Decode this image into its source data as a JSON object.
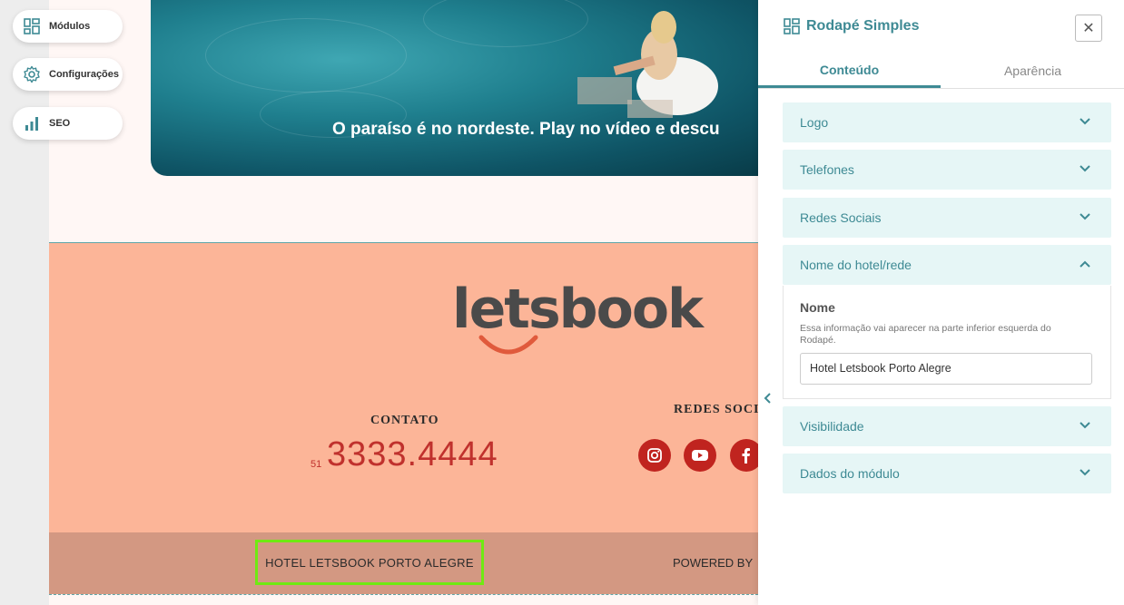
{
  "sidebar": {
    "modulos_label": "Módulos",
    "configuracoes_label": "Configurações",
    "seo_label": "SEO"
  },
  "hero": {
    "caption": "O paraíso é no nordeste. Play no vídeo e descu"
  },
  "footer": {
    "logo_text": "letsbook",
    "contato_title": "CONTATO",
    "ddd": "51",
    "phone": "3333.4444",
    "redes_title": "REDES SOCIA",
    "hotel_name": "HOTEL LETSBOOK PORTO ALEGRE",
    "powered_by": "POWERED BY"
  },
  "panel": {
    "title": "Rodapé Simples",
    "close_symbol": "✕",
    "tabs": [
      {
        "label": "Conteúdo",
        "active": true
      },
      {
        "label": "Aparência",
        "active": false
      }
    ],
    "accordion": [
      {
        "label": "Logo",
        "expanded": false
      },
      {
        "label": "Telefones",
        "expanded": false
      },
      {
        "label": "Redes Sociais",
        "expanded": false
      },
      {
        "label": "Nome do hotel/rede",
        "expanded": true
      },
      {
        "label": "Visibilidade",
        "expanded": false
      },
      {
        "label": "Dados do módulo",
        "expanded": false
      }
    ],
    "nome_section": {
      "label": "Nome",
      "help": "Essa informação vai aparecer na parte inferior esquerda do Rodapé.",
      "input_value": "Hotel Letsbook Porto Alegre"
    }
  },
  "colors": {
    "accent": "#3e8a94",
    "footer_bg": "#fcb598",
    "footer_bar_bg": "#d39882",
    "phone_red": "#c0312d",
    "highlight_green": "#6fea12"
  }
}
